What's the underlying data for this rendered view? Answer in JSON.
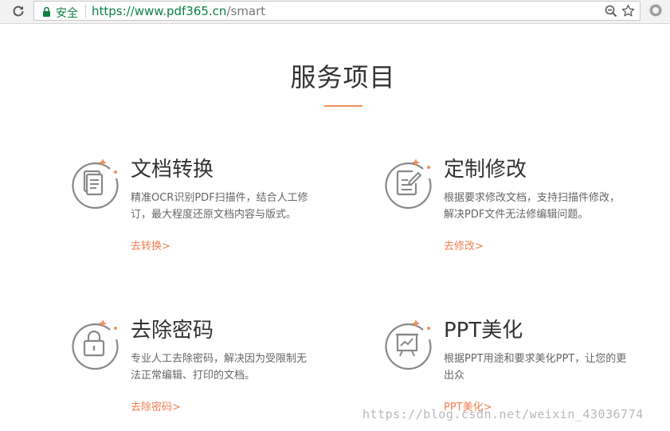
{
  "browser": {
    "secure_label": "安全",
    "url_host": "https://www.pdf365.cn",
    "url_path": "/smart"
  },
  "page": {
    "title": "服务项目",
    "accent_color": "#f08e5e"
  },
  "services": [
    {
      "title": "文档转换",
      "description": "精准OCR识别PDF扫描件，结合人工修订，最大程度还原文档内容与版式。",
      "link": "去转换>",
      "icon": "document-icon"
    },
    {
      "title": "定制修改",
      "description": "根据要求修改文档，支持扫描件修改，解决PDF文件无法修编辑问题。",
      "link": "去修改>",
      "icon": "edit-document-icon"
    },
    {
      "title": "去除密码",
      "description": "专业人工去除密码，解决因为受限制无法正常编辑、打印的文档。",
      "link": "去除密码>",
      "icon": "lock-icon"
    },
    {
      "title": "PPT美化",
      "description": "根据PPT用途和要求美化PPT，让您的更出众",
      "link": "PPT美化>",
      "icon": "presentation-icon"
    }
  ],
  "watermark": "https://blog.csdn.net/weixin_43036774"
}
